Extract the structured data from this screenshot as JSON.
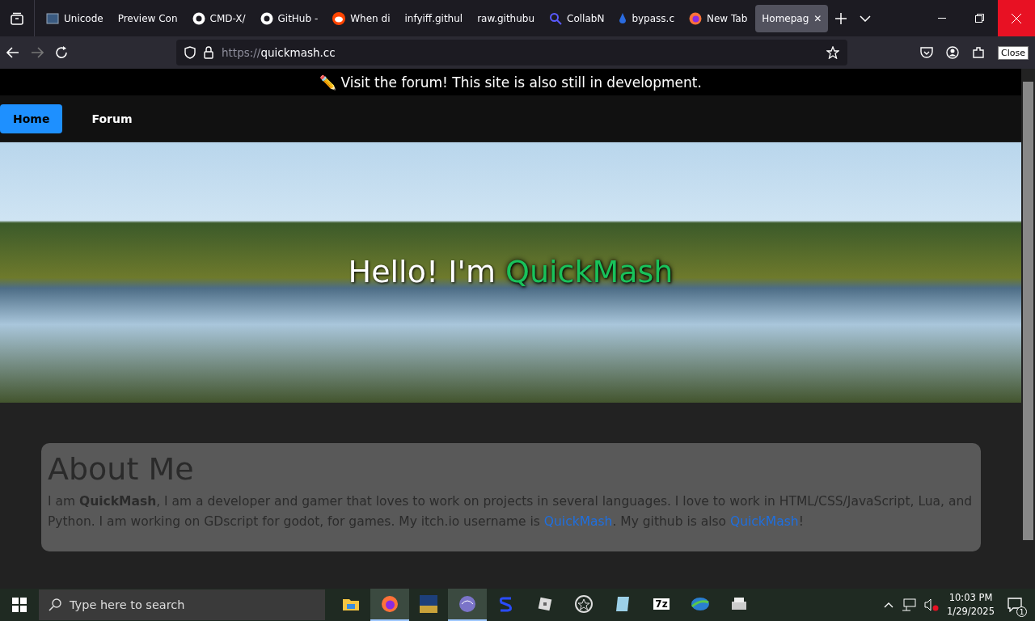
{
  "browser": {
    "tabs": [
      {
        "label": "Unicode",
        "selected": false
      },
      {
        "label": "Preview Con",
        "selected": false
      },
      {
        "label": "CMD-X/",
        "selected": false
      },
      {
        "label": "GitHub -",
        "selected": false
      },
      {
        "label": "When di",
        "selected": false
      },
      {
        "label": "infyiff.githul",
        "selected": false
      },
      {
        "label": "raw.githubu",
        "selected": false
      },
      {
        "label": "CollabN",
        "selected": false
      },
      {
        "label": "bypass.c",
        "selected": false
      },
      {
        "label": "New Tab",
        "selected": false
      },
      {
        "label": "Homepag",
        "selected": true
      }
    ],
    "close_tab": "✕",
    "url_scheme": "https://",
    "url_host": "quickmash.cc",
    "tooltip": "Close"
  },
  "page": {
    "banner": "✏️ Visit the forum! This site is also still in development.",
    "nav": [
      {
        "label": "Home",
        "selected": true
      },
      {
        "label": "Forum",
        "selected": false
      }
    ],
    "hero": {
      "greeting": "Hello! I'm",
      "name": "QuickMash"
    },
    "about": {
      "heading": "About Me",
      "paragraph": [
        {
          "kind": "text",
          "text": "I am "
        },
        {
          "kind": "bold",
          "text": "QuickMash"
        },
        {
          "kind": "text",
          "text": ", I am a developer and gamer that loves to work on projects in several languages. I love to work in HTML/CSS/JavaScript, Lua, and Python. I am working on GDscript for godot, for games. My itch.io username is "
        },
        {
          "kind": "link",
          "text": "QuickMash"
        },
        {
          "kind": "text",
          "text": ". My github is also "
        },
        {
          "kind": "link",
          "text": "QuickMash"
        },
        {
          "kind": "text",
          "text": "!"
        }
      ]
    }
  },
  "taskbar": {
    "search_placeholder": "Type here to search",
    "apps": [
      {
        "kind": "folder",
        "active": false
      },
      {
        "kind": "firefox",
        "active": true
      },
      {
        "kind": "game",
        "active": false
      },
      {
        "kind": "orb",
        "active": true
      },
      {
        "kind": "s",
        "active": false
      },
      {
        "kind": "cube",
        "active": false
      },
      {
        "kind": "star",
        "active": false
      },
      {
        "kind": "notepad",
        "active": false
      },
      {
        "kind": "sevenzip",
        "label": "7z",
        "active": false
      },
      {
        "kind": "download",
        "active": false
      },
      {
        "kind": "printer",
        "active": false
      }
    ],
    "time": "10:03 PM",
    "date": "1/29/2025",
    "notifications": "1"
  }
}
